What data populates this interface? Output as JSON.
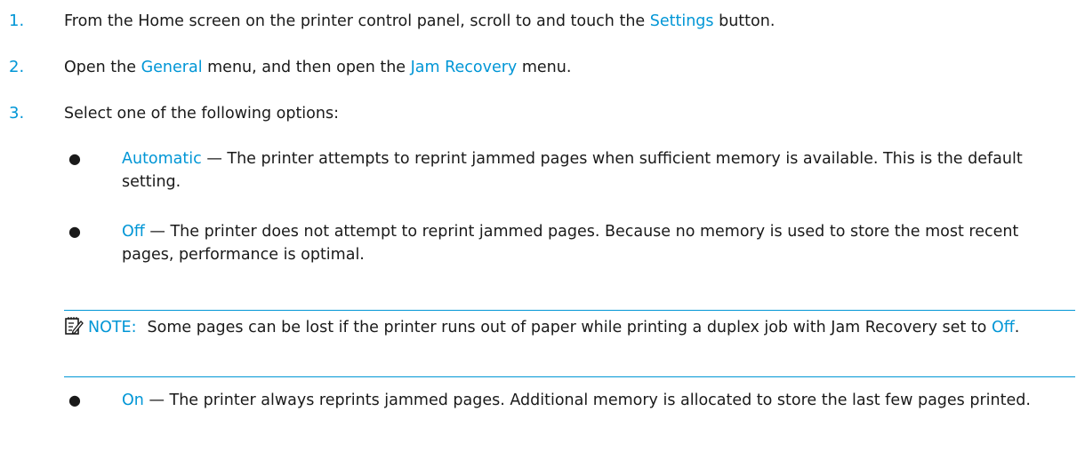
{
  "steps": [
    {
      "num": "1.",
      "pre": "From the Home screen on the printer control panel, scroll to and touch the ",
      "link": "Settings",
      "post": " button."
    },
    {
      "num": "2.",
      "pre": "Open the ",
      "link1": "General",
      "mid": " menu, and then open the ",
      "link2": "Jam Recovery",
      "post": " menu."
    },
    {
      "num": "3.",
      "text": "Select one of the following options:"
    }
  ],
  "options": [
    {
      "term": "Automatic",
      "desc": " — The printer attempts to reprint jammed pages when sufficient memory is available. This is the default setting."
    },
    {
      "term": "Off",
      "desc": " — The printer does not attempt to reprint jammed pages. Because no memory is used to store the most recent pages, performance is optimal."
    },
    {
      "term": "On",
      "desc": " — The printer always reprints jammed pages. Additional memory is allocated to store the last few pages printed."
    }
  ],
  "note": {
    "label": "NOTE:",
    "text": "Some pages can be lost if the printer runs out of paper while printing a duplex job with Jam Recovery set to ",
    "term": "Off",
    "end": "."
  },
  "icons": {
    "note": "note-pencil-icon",
    "bullet": "bullet-dot-icon"
  },
  "colors": {
    "accent": "#0096d6",
    "text": "#1a1a1a"
  }
}
